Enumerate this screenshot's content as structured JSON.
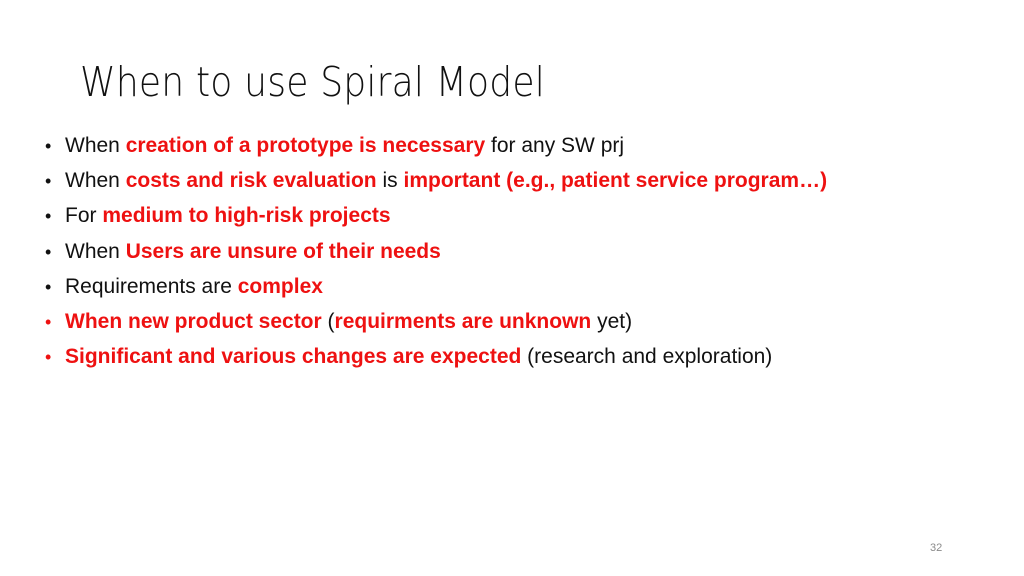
{
  "slide": {
    "title": "When to use Spiral Model",
    "page_number": "32",
    "colors": {
      "text": "#111111",
      "highlight": "#ee1111",
      "page_number": "#8a8a8a"
    },
    "bullets": [
      {
        "bullet_color": "plain",
        "segments": [
          {
            "text": "When ",
            "style": "plain"
          },
          {
            "text": "creation of a prototype is necessary",
            "style": "hl"
          },
          {
            "text": " for any SW prj",
            "style": "plain"
          }
        ]
      },
      {
        "bullet_color": "plain",
        "segments": [
          {
            "text": "When ",
            "style": "plain"
          },
          {
            "text": "costs and risk evaluation",
            "style": "hl"
          },
          {
            "text": " is ",
            "style": "plain"
          },
          {
            "text": "important (e.g., patient service program…)",
            "style": "hl"
          }
        ]
      },
      {
        "bullet_color": "plain",
        "segments": [
          {
            "text": "For ",
            "style": "plain"
          },
          {
            "text": "medium to high-risk projects",
            "style": "hl"
          }
        ]
      },
      {
        "bullet_color": "plain",
        "segments": [
          {
            "text": "When ",
            "style": "plain"
          },
          {
            "text": "Users are unsure of their needs",
            "style": "hl"
          }
        ]
      },
      {
        "bullet_color": "plain",
        "segments": [
          {
            "text": "Requirements are ",
            "style": "plain"
          },
          {
            "text": "complex",
            "style": "hl"
          }
        ]
      },
      {
        "bullet_color": "hl",
        "segments": [
          {
            "text": "When new product sector",
            "style": "hl"
          },
          {
            "text": " (",
            "style": "plain"
          },
          {
            "text": "requirments are unknown",
            "style": "hl"
          },
          {
            "text": " yet)",
            "style": "plain"
          }
        ]
      },
      {
        "bullet_color": "hl",
        "segments": [
          {
            "text": "Significant and various changes are expected",
            "style": "hl"
          },
          {
            "text": " (research and exploration)",
            "style": "plain"
          }
        ]
      }
    ]
  }
}
